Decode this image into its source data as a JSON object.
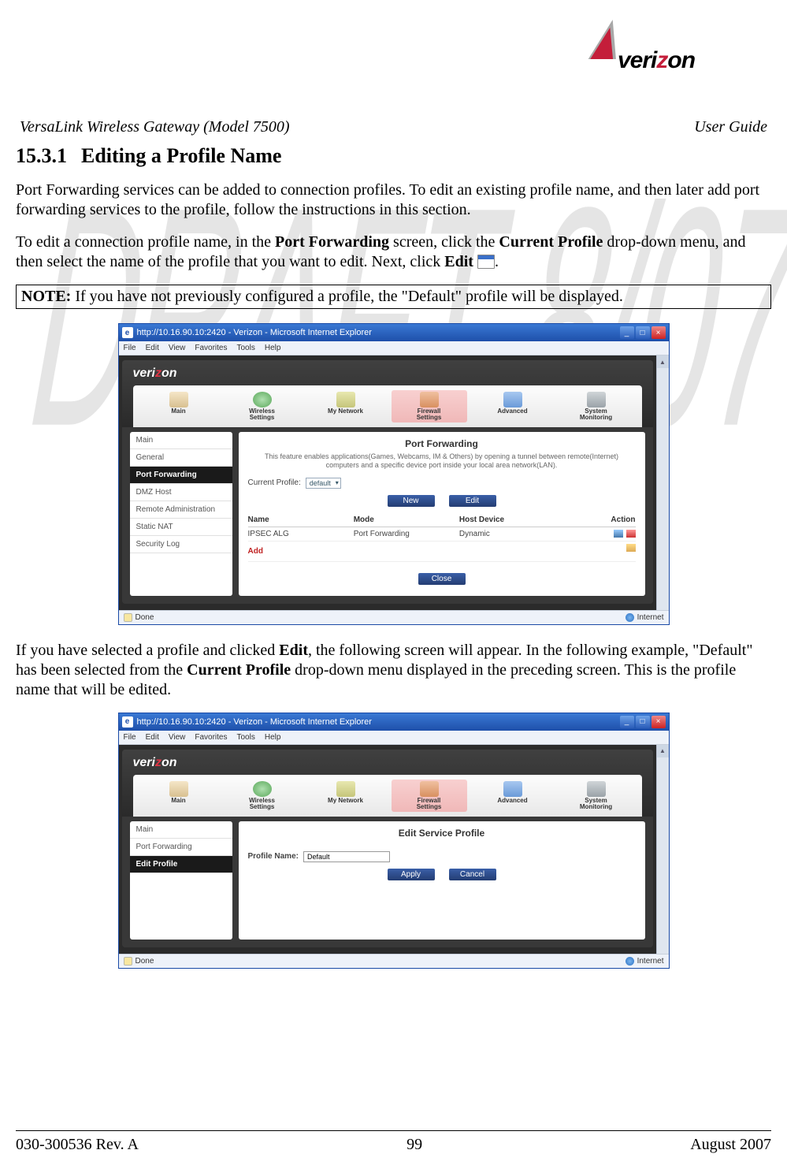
{
  "header": {
    "product": "VersaLink Wireless Gateway (Model 7500)",
    "guide": "User Guide"
  },
  "section": {
    "number": "15.3.1",
    "title": "Editing a Profile Name"
  },
  "paragraphs": {
    "p1": "Port Forwarding services can be added to connection profiles. To edit an existing profile name, and then later add port forwarding services to the profile, follow the instructions in this section.",
    "p2_a": "To edit a connection profile name, in the ",
    "p2_b": "Port Forwarding",
    "p2_c": " screen, click the ",
    "p2_d": "Current Profile",
    "p2_e": " drop-down menu, and then select the name of the profile that you want to edit. Next, click ",
    "p2_f": "Edit",
    "p2_g": ".",
    "note_label": "NOTE:",
    "note_text": " If you have not previously configured a profile, the \"Default\" profile will be displayed.",
    "p3_a": "If you have selected a profile and clicked ",
    "p3_b": "Edit",
    "p3_c": ", the following screen will appear. In the following example, \"Default\" has been selected from the ",
    "p3_d": "Current Profile",
    "p3_e": " drop-down menu displayed in the preceding screen. This is the profile name that will be edited."
  },
  "ie_common": {
    "title": "http://10.16.90.10:2420 - Verizon - Microsoft Internet Explorer",
    "menu": [
      "File",
      "Edit",
      "View",
      "Favorites",
      "Tools",
      "Help"
    ],
    "status_left": "Done",
    "status_right": "Internet"
  },
  "router": {
    "brand_pre": "veri",
    "brand_red": "z",
    "brand_post": "on",
    "tabs": [
      {
        "label": "Main",
        "ico": "ico-main"
      },
      {
        "label": "Wireless\nSettings",
        "ico": "ico-wifi"
      },
      {
        "label": "My Network",
        "ico": "ico-net"
      },
      {
        "label": "Firewall\nSettings",
        "ico": "ico-fw",
        "active": true
      },
      {
        "label": "Advanced",
        "ico": "ico-adv"
      },
      {
        "label": "System\nMonitoring",
        "ico": "ico-mon"
      }
    ]
  },
  "screen1": {
    "sidebar": [
      "Main",
      "General",
      "Port Forwarding",
      "DMZ Host",
      "Remote Administration",
      "Static NAT",
      "Security Log"
    ],
    "sidebar_active": 2,
    "title": "Port Forwarding",
    "desc": "This feature enables applications(Games, Webcams, IM & Others) by opening a tunnel between remote(Internet) computers and a specific device port inside your local area network(LAN).",
    "profile_label": "Current Profile:",
    "profile_value": "default",
    "btn_new": "New",
    "btn_edit": "Edit",
    "cols": {
      "name": "Name",
      "mode": "Mode",
      "host": "Host Device",
      "action": "Action"
    },
    "row": {
      "name": "IPSEC ALG",
      "mode": "Port Forwarding",
      "host": "Dynamic"
    },
    "add": "Add",
    "btn_close": "Close"
  },
  "screen2": {
    "sidebar": [
      "Main",
      "Port Forwarding",
      "Edit Profile"
    ],
    "sidebar_active": 2,
    "title": "Edit Service Profile",
    "name_label": "Profile Name:",
    "name_value": "Default",
    "btn_apply": "Apply",
    "btn_cancel": "Cancel"
  },
  "footer": {
    "left": "030-300536 Rev. A",
    "center": "99",
    "right": "August 2007"
  },
  "watermark": "DRAFT 8/07"
}
